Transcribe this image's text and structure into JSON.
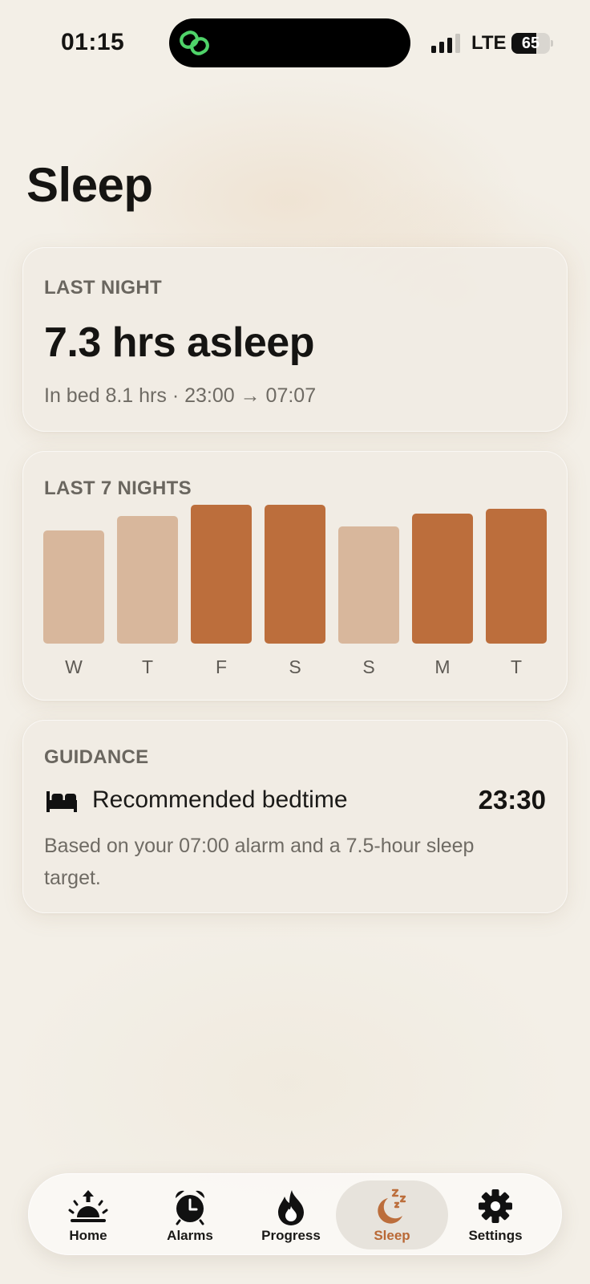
{
  "status_bar": {
    "time": "01:15",
    "network": "LTE",
    "battery": "65",
    "battery_level": 0.65
  },
  "colors": {
    "accent": "#bc6e3c",
    "accent_muted": "#d8b79c",
    "background": "#f3efe7",
    "island_app": "#4fd369"
  },
  "page": {
    "title": "Sleep"
  },
  "last_night": {
    "label": "LAST NIGHT",
    "asleep": "7.3 hrs asleep",
    "in_bed": "In bed 8.1 hrs · 23:00 → 07:07"
  },
  "last_7_nights": {
    "label": "LAST 7 NIGHTS",
    "nights": [
      {
        "day": "W",
        "hours": 6.2,
        "met_target": false
      },
      {
        "day": "T",
        "hours": 7.0,
        "met_target": false
      },
      {
        "day": "F",
        "hours": 7.6,
        "met_target": true
      },
      {
        "day": "S",
        "hours": 7.6,
        "met_target": true
      },
      {
        "day": "S",
        "hours": 6.4,
        "met_target": false
      },
      {
        "day": "M",
        "hours": 7.1,
        "met_target": true
      },
      {
        "day": "T",
        "hours": 7.4,
        "met_target": true
      }
    ]
  },
  "guidance": {
    "label": "GUIDANCE",
    "icon": "bed-icon",
    "title": "Recommended bedtime",
    "time": "23:30",
    "description": "Based on your 07:00 alarm and a 7.5-hour sleep target."
  },
  "tabs": [
    {
      "id": "home",
      "label": "Home",
      "icon": "sunrise-icon",
      "active": false
    },
    {
      "id": "alarms",
      "label": "Alarms",
      "icon": "alarm-clock-icon",
      "active": false
    },
    {
      "id": "progress",
      "label": "Progress",
      "icon": "flame-icon",
      "active": false
    },
    {
      "id": "sleep",
      "label": "Sleep",
      "icon": "moon-zzz-icon",
      "active": true
    },
    {
      "id": "settings",
      "label": "Settings",
      "icon": "gear-icon",
      "active": false
    }
  ]
}
